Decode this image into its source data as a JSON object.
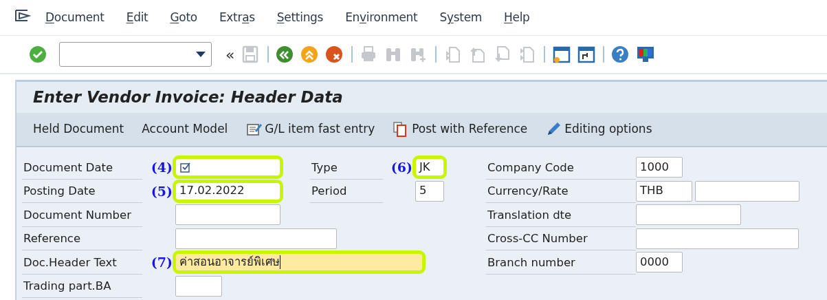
{
  "menu": [
    {
      "key": "D",
      "after": "ocument"
    },
    {
      "key": "E",
      "after": "dit"
    },
    {
      "key": "G",
      "after": "oto"
    },
    {
      "before": "Extr",
      "key": "a",
      "after": "s"
    },
    {
      "key": "S",
      "after": "ettings"
    },
    {
      "before": "En",
      "key": "v",
      "after": "ironment"
    },
    {
      "before": "S",
      "key": "y",
      "after": "stem"
    },
    {
      "key": "H",
      "after": "elp"
    }
  ],
  "toolbar": {
    "back_glyph": "«",
    "buttons": [
      {
        "disabled": false
      },
      {
        "disabled": true
      },
      {
        "disabled": false
      },
      {
        "disabled": false
      },
      {
        "disabled": false
      },
      {
        "disabled": true
      },
      {
        "disabled": true
      },
      {
        "disabled": true
      },
      {
        "disabled": true
      },
      {
        "disabled": true
      },
      {
        "disabled": true
      },
      {
        "disabled": true
      },
      {
        "disabled": false
      },
      {
        "disabled": false
      },
      {
        "disabled": false
      },
      {
        "disabled": false
      }
    ]
  },
  "title": "Enter Vendor Invoice: Header Data",
  "app_toolbar": [
    {
      "kind": "text",
      "label": "Held Document"
    },
    {
      "kind": "text",
      "label": "Account Model"
    },
    {
      "kind": "icon",
      "label": "G/L item fast entry"
    },
    {
      "kind": "icon",
      "label": "Post with Reference"
    },
    {
      "kind": "icon",
      "label": "Editing options"
    }
  ],
  "left_fields": [
    {
      "label": "Document Date",
      "annotation": "(4)",
      "inputs": [
        {
          "highlighted": true,
          "required": true,
          "focused": false
        }
      ]
    },
    {
      "label": "Posting Date",
      "annotation": "(5)",
      "inputs": [
        {
          "value": "17.02.2022",
          "highlighted": true,
          "required": false,
          "focused": false
        }
      ]
    },
    {
      "label": "Document Number",
      "inputs": [
        {
          "highlighted": false,
          "required": false,
          "focused": false
        }
      ]
    },
    {
      "label": "Reference",
      "inputs": [
        {
          "highlighted": false,
          "required": false,
          "focused": false
        }
      ]
    },
    {
      "label": "Doc.Header Text",
      "annotation": "(7)",
      "inputs": [
        {
          "value": "ค่าสอนอาจารย์พิเศษ",
          "highlighted": true,
          "required": false,
          "focused": true
        }
      ]
    },
    {
      "label": "Trading part.BA",
      "inputs": [
        {
          "highlighted": false,
          "required": false,
          "focused": false
        }
      ]
    }
  ],
  "middle_fields": [
    {
      "label": "Type",
      "annotation": "(6)",
      "inputs": [
        {
          "value": "JK",
          "highlighted": true,
          "required": false,
          "focused": false
        }
      ]
    },
    {
      "label": "Period",
      "inputs": [
        {
          "value": "5",
          "highlighted": false,
          "required": false,
          "focused": false
        }
      ]
    }
  ],
  "right_fields": [
    {
      "label": "Company Code",
      "inputs": [
        {
          "value": "1000",
          "highlighted": false,
          "required": false,
          "focused": false
        }
      ]
    },
    {
      "label": "Currency/Rate",
      "inputs": [
        {
          "value": "THB",
          "highlighted": false,
          "required": false,
          "focused": false
        },
        {
          "highlighted": false,
          "required": false,
          "focused": false
        }
      ]
    },
    {
      "label": "Translation dte",
      "inputs": [
        {
          "highlighted": false,
          "required": false,
          "focused": false
        }
      ]
    },
    {
      "label": "Cross-CC Number",
      "inputs": [
        {
          "highlighted": false,
          "required": false,
          "focused": false
        }
      ]
    },
    {
      "label": "Branch number",
      "inputs": [
        {
          "value": "0000",
          "highlighted": false,
          "required": false,
          "focused": false
        }
      ]
    }
  ]
}
